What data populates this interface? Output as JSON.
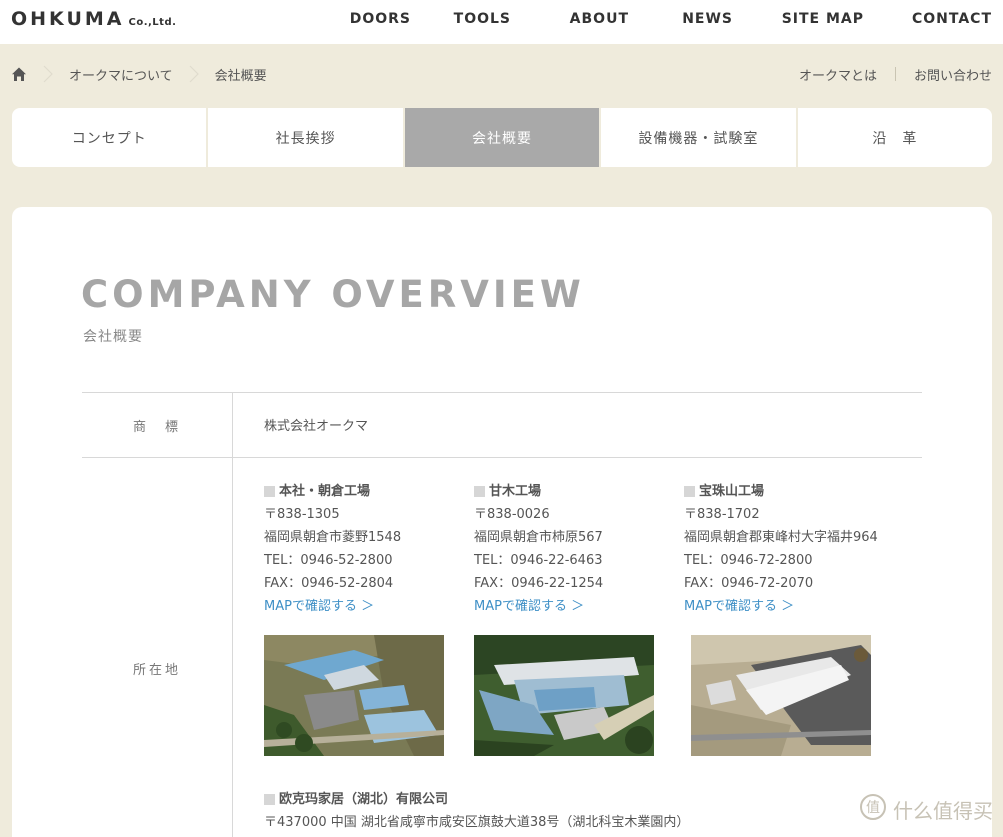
{
  "header": {
    "logo": "OHKUMA",
    "logo_suffix": "Co.,Ltd.",
    "nav": [
      "DOORS",
      "TOOLS",
      "ABOUT",
      "NEWS",
      "SITE MAP",
      "CONTACT"
    ]
  },
  "breadcrumb": {
    "home_icon": "home-icon",
    "items": [
      "オークマについて",
      "会社概要"
    ],
    "right_links": [
      "オークマとは",
      "お問い合わせ"
    ]
  },
  "tabs": [
    {
      "label": "コンセプト",
      "active": false
    },
    {
      "label": "社長挨拶",
      "active": false
    },
    {
      "label": "会社概要",
      "active": true
    },
    {
      "label": "設備機器・試験室",
      "active": false
    },
    {
      "label": "沿　革",
      "active": false
    }
  ],
  "main": {
    "title": "COMPANY OVERVIEW",
    "subtitle": "会社概要",
    "rows": {
      "trademark": {
        "label": "商　標",
        "value": "株式会社オークマ"
      },
      "location": {
        "label": "所在地"
      }
    },
    "factories": [
      {
        "name": "本社・朝倉工場",
        "postal": "〒838-1305",
        "address": "福岡県朝倉市菱野1548",
        "tel": "TEL：0946-52-2800",
        "fax": "FAX：0946-52-2804",
        "map": "MAPで確認する ＞"
      },
      {
        "name": "甘木工場",
        "postal": "〒838-0026",
        "address": "福岡県朝倉市柿原567",
        "tel": "TEL：0946-22-6463",
        "fax": "FAX：0946-22-1254",
        "map": "MAPで確認する ＞"
      },
      {
        "name": "宝珠山工場",
        "postal": "〒838-1702",
        "address": "福岡県朝倉郡東峰村大字福井964",
        "tel": "TEL：0946-72-2800",
        "fax": "FAX：0946-72-2070",
        "map": "MAPで確認する ＞"
      }
    ],
    "intl": {
      "name": "欧克玛家居（湖北）有限公司",
      "address": "〒437000 中国 湖北省咸寧市咸安区旗鼓大道38号（湖北科宝木業園内）"
    }
  },
  "watermark": {
    "text": "什么值得买"
  },
  "colors": {
    "background": "#efebdc",
    "active_tab": "#a9a9a9",
    "link": "#3e8fc6",
    "title": "#a6a6a6"
  }
}
